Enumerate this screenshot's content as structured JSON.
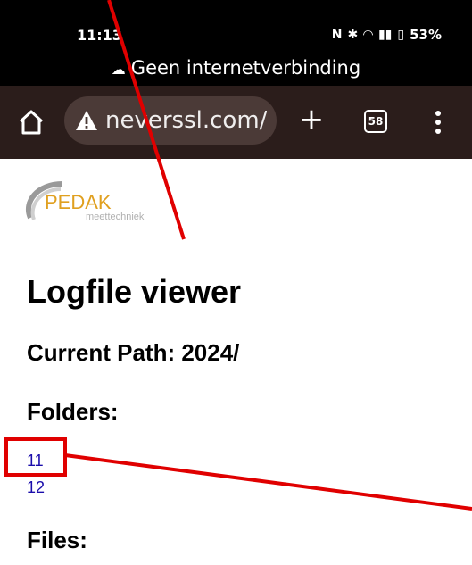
{
  "status_bar": {
    "time": "11:13",
    "icons": [
      "nfc-icon",
      "bluetooth-icon",
      "wifi-icon",
      "signal-icon",
      "battery-icon"
    ],
    "battery": "53%",
    "offline_message": "Geen internetverbinding"
  },
  "toolbar": {
    "url": "neverssl.com/",
    "tab_count": "58"
  },
  "page": {
    "logo_text": "PEDAK",
    "logo_subtext": "meettechniek",
    "title": "Logfile viewer",
    "current_path": "Current Path: 2024/",
    "folders_heading": "Folders:",
    "folders": [
      "11",
      "12"
    ],
    "files_heading": "Files:"
  },
  "annotation": {
    "color": "#e00000"
  }
}
